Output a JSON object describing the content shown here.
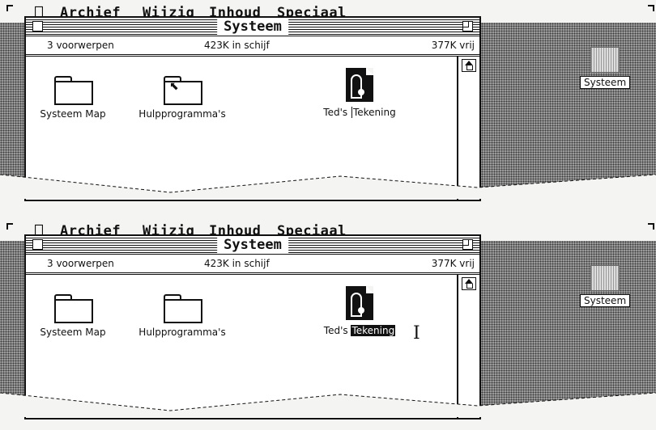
{
  "menubar": {
    "apple_icon": "apple-icon",
    "items": [
      "Archief",
      "Wijzig",
      "Inhoud",
      "Speciaal"
    ]
  },
  "window": {
    "title": "Systeem",
    "info": {
      "items": "3 voorwerpen",
      "disk": "423K in schijf",
      "free": "377K vrij"
    },
    "icons": {
      "folder1": "Systeem Map",
      "folder2": "Hulpprogramma's",
      "doc_prefix": "Ted's",
      "doc_suffix": "Tekening"
    }
  },
  "desktop": {
    "disk_label": "Systeem"
  },
  "colors": {
    "desktop": "#9a9a9a",
    "text": "#111111",
    "background": "#f4f4f2"
  }
}
